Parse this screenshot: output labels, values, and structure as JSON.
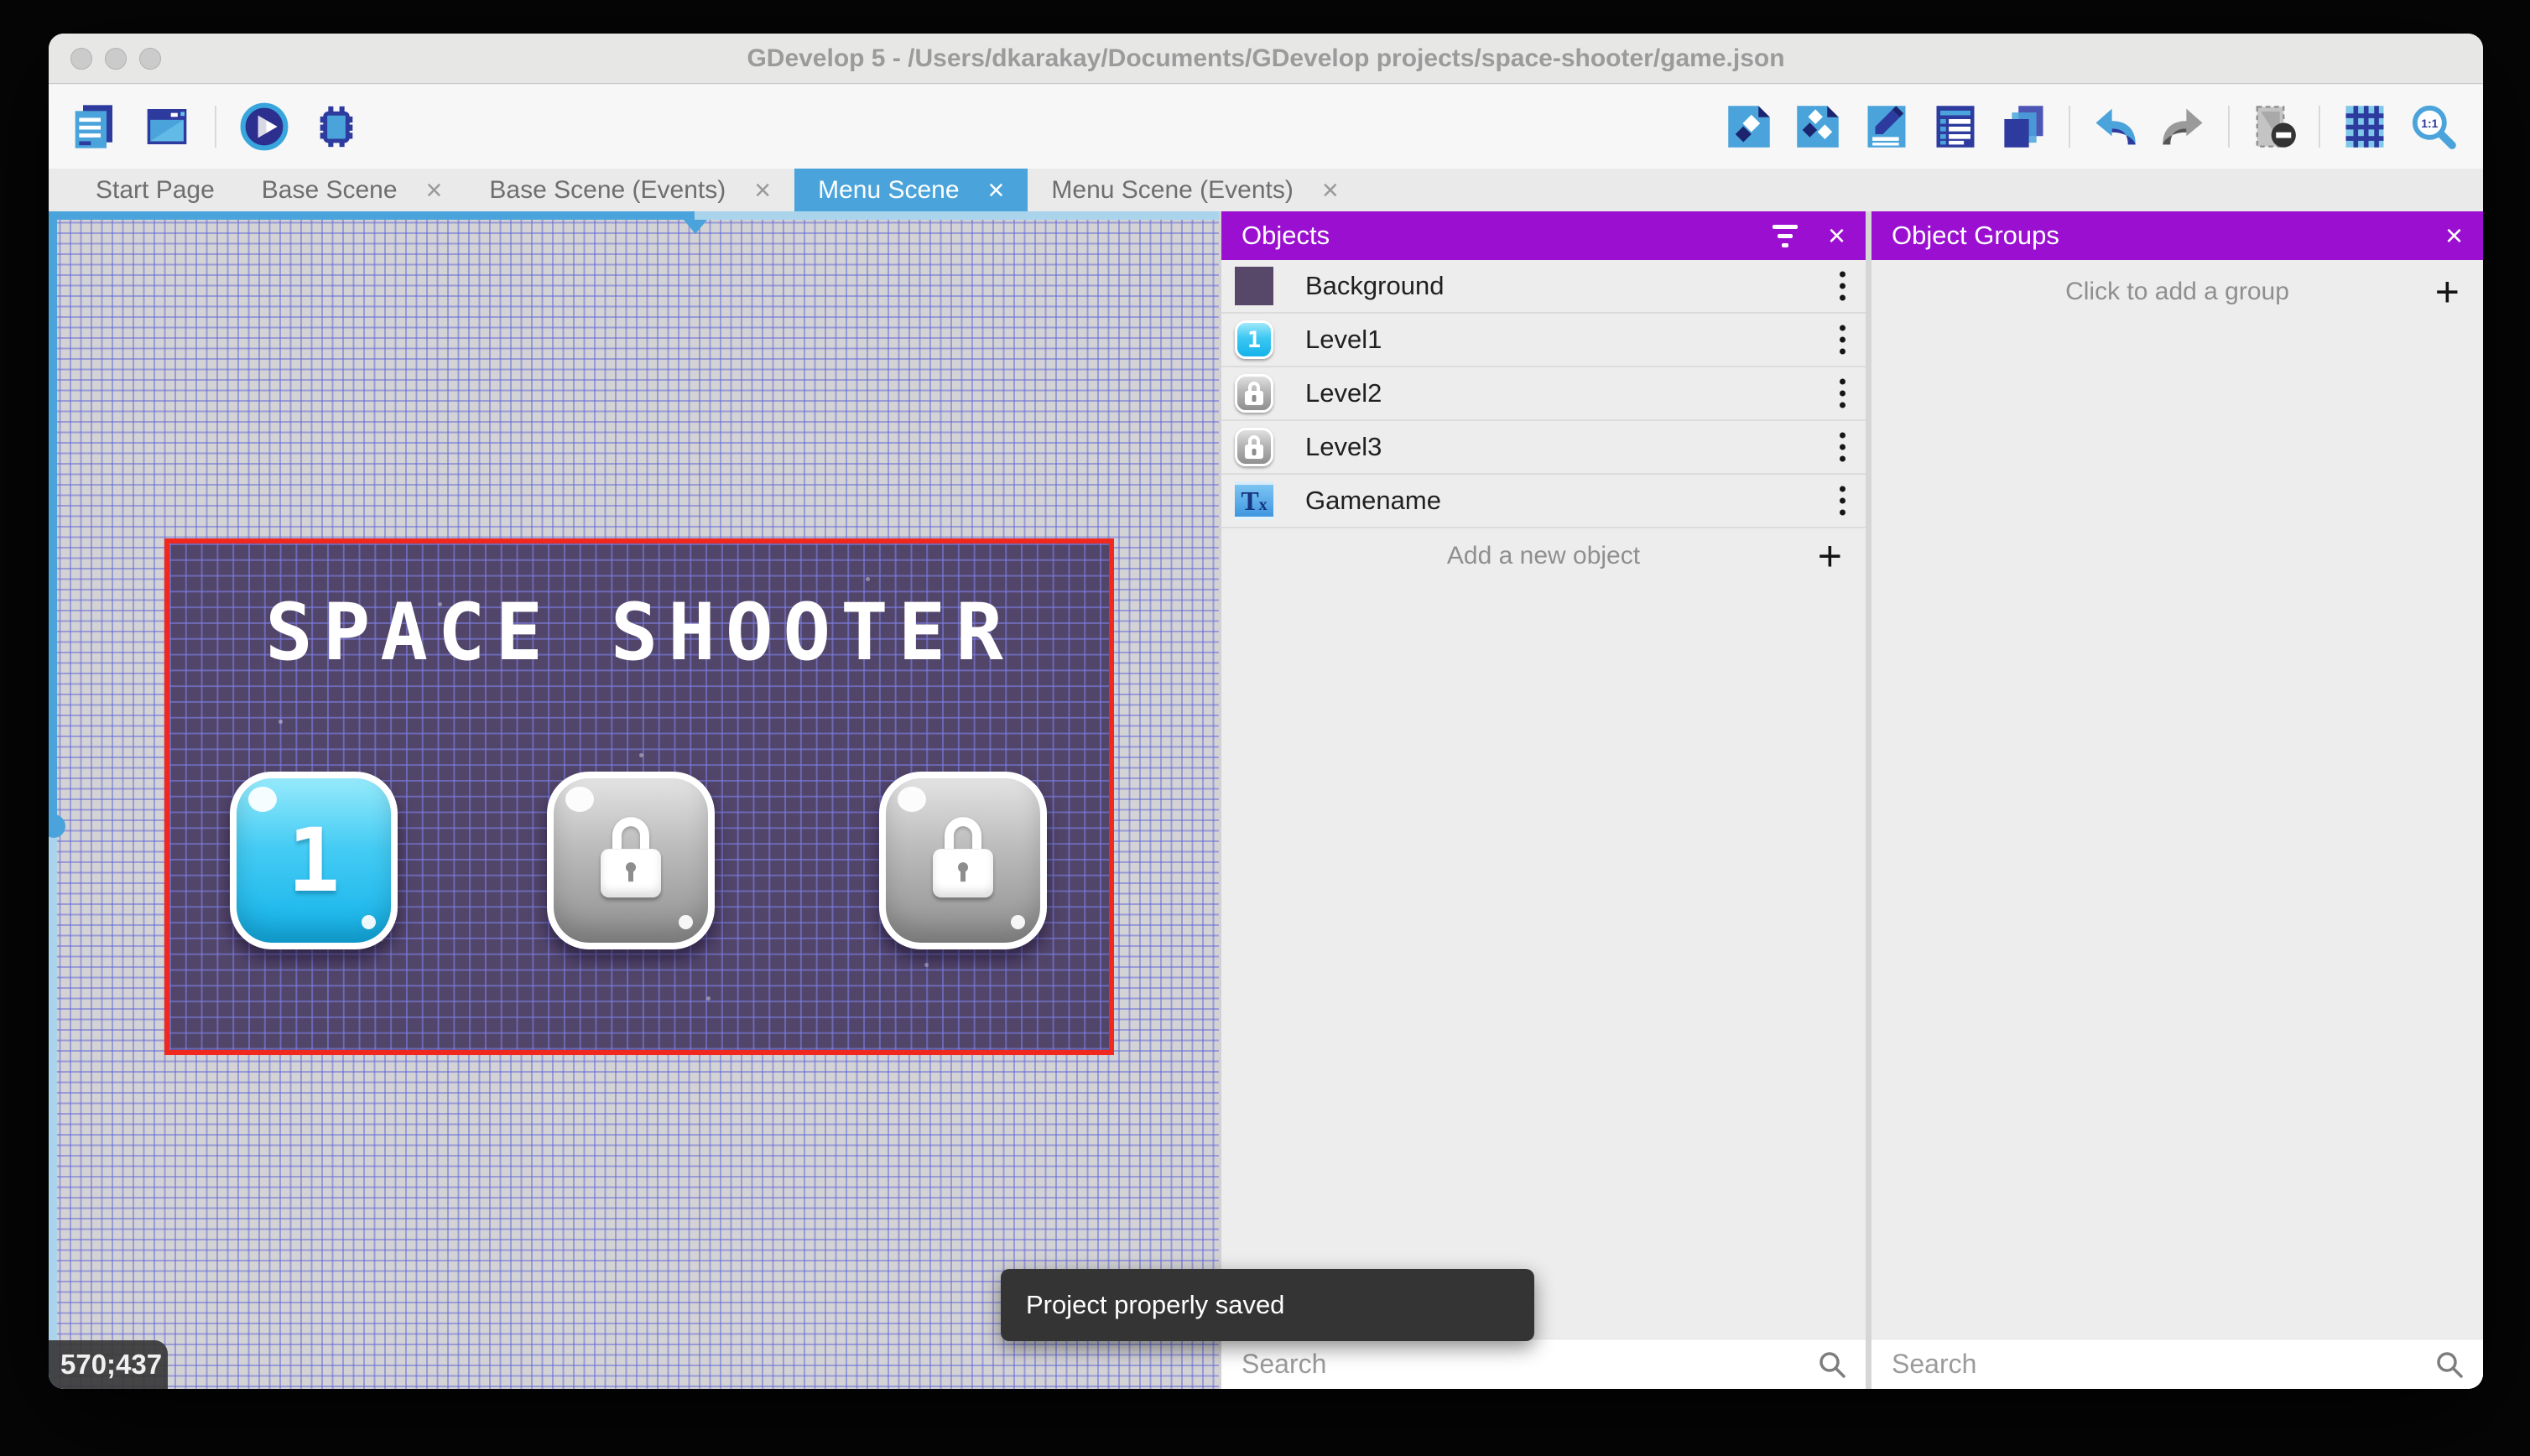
{
  "window": {
    "title": "GDevelop 5 - /Users/dkarakay/Documents/GDevelop projects/space-shooter/game.json"
  },
  "toolbar": {
    "left_icons": [
      "project-manager",
      "preview-window",
      "play",
      "debug"
    ],
    "right_icons": [
      "add-object",
      "add-object-group",
      "edit-scene-properties",
      "instances-list",
      "layers",
      "undo",
      "redo",
      "toggle-mask",
      "grid",
      "zoom-original"
    ]
  },
  "tabs": [
    {
      "label": "Start Page",
      "active": false,
      "closable": false
    },
    {
      "label": "Base Scene",
      "active": false,
      "closable": true
    },
    {
      "label": "Base Scene (Events)",
      "active": false,
      "closable": true
    },
    {
      "label": "Menu Scene",
      "active": true,
      "closable": true
    },
    {
      "label": "Menu Scene (Events)",
      "active": false,
      "closable": true
    }
  ],
  "canvas": {
    "coordinates": "570;437",
    "scene": {
      "title": "SPACE SHOOTER",
      "level_buttons": [
        {
          "label": "1",
          "locked": false
        },
        {
          "label": "",
          "locked": true
        },
        {
          "label": "",
          "locked": true
        }
      ]
    }
  },
  "objects_panel": {
    "title": "Objects",
    "items": [
      {
        "name": "Background",
        "icon": "background-thumbnail"
      },
      {
        "name": "Level1",
        "icon": "level-button-thumbnail",
        "badge": "1"
      },
      {
        "name": "Level2",
        "icon": "locked-button-thumbnail"
      },
      {
        "name": "Level3",
        "icon": "locked-button-thumbnail"
      },
      {
        "name": "Gamename",
        "icon": "text-object-thumbnail",
        "thumb_text_main": "T",
        "thumb_text_sub": "x"
      }
    ],
    "add_label": "Add a new object",
    "search_placeholder": "Search"
  },
  "groups_panel": {
    "title": "Object Groups",
    "empty_label": "Click to add a group",
    "search_placeholder": "Search"
  },
  "toast": {
    "message": "Project properly saved"
  },
  "colors": {
    "accent_blue": "#4AA4DB",
    "panel_purple": "#9B10D0",
    "selection_red": "#F0281E"
  }
}
